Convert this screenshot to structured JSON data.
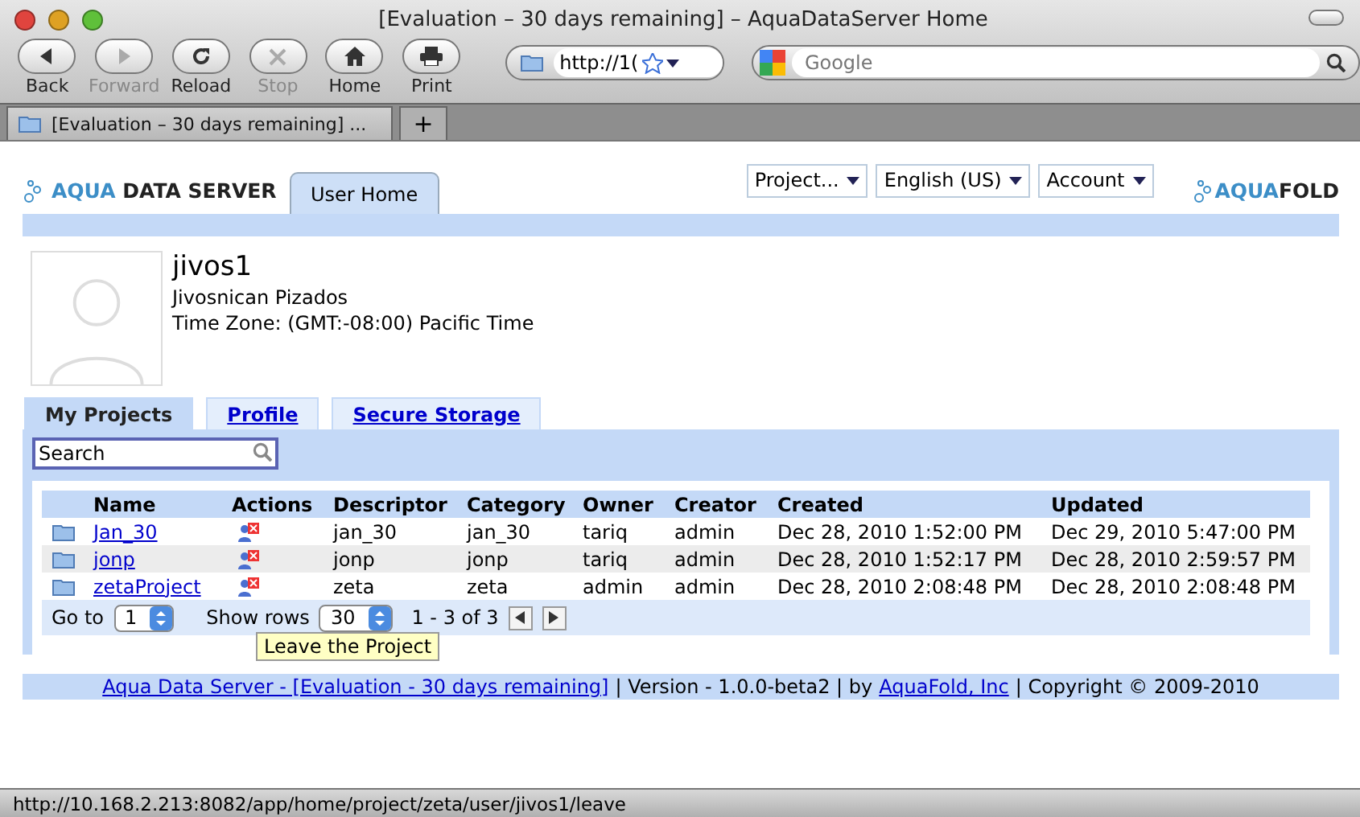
{
  "window": {
    "title": "[Evaluation – 30 days remaining] – AquaDataServer Home"
  },
  "toolbar": [
    {
      "label": "Back",
      "kind": "back",
      "disabled": false
    },
    {
      "label": "Forward",
      "kind": "forward",
      "disabled": true
    },
    {
      "label": "Reload",
      "kind": "reload",
      "disabled": false
    },
    {
      "label": "Stop",
      "kind": "stop",
      "disabled": true
    },
    {
      "label": "Home",
      "kind": "home",
      "disabled": false
    },
    {
      "label": "Print",
      "kind": "print",
      "disabled": false
    }
  ],
  "address": {
    "value": "http://1("
  },
  "web_search": {
    "placeholder": "Google"
  },
  "browser_tabs": [
    {
      "label": "[Evaluation – 30 days remaining] ...",
      "selected": true
    }
  ],
  "new_tab": "+",
  "app": {
    "logo": {
      "part1": "AQUA",
      "part2": "DATA SERVER"
    },
    "nav_tabs": [
      {
        "label": "User Home",
        "selected": true
      }
    ],
    "menus": [
      "Project...",
      "English (US)",
      "Account"
    ],
    "brand": {
      "part1": "AQUA",
      "part2": "FOLD"
    }
  },
  "user": {
    "username": "jivos1",
    "full_name": "Jivosnican Pizados",
    "time_zone": "Time Zone: (GMT:-08:00) Pacific Time"
  },
  "tabs": [
    {
      "label": "My Projects",
      "selected": true
    },
    {
      "label": "Profile",
      "selected": false
    },
    {
      "label": "Secure Storage",
      "selected": false
    }
  ],
  "search": {
    "value": "Search"
  },
  "table": {
    "columns": [
      "Name",
      "Actions",
      "Descriptor",
      "Category",
      "Owner",
      "Creator",
      "Created",
      "Updated"
    ],
    "rows": [
      {
        "name": "Jan_30",
        "descriptor": "jan_30",
        "category": "jan_30",
        "owner": "tariq",
        "creator": "admin",
        "created": "Dec 28, 2010 1:52:00 PM",
        "updated": "Dec 29, 2010 5:47:00 PM"
      },
      {
        "name": "jonp",
        "descriptor": "jonp",
        "category": "jonp",
        "owner": "tariq",
        "creator": "admin",
        "created": "Dec 28, 2010 1:52:17 PM",
        "updated": "Dec 28, 2010 2:59:57 PM"
      },
      {
        "name": "zetaProject",
        "descriptor": "zeta",
        "category": "zeta",
        "owner": "admin",
        "creator": "admin",
        "created": "Dec 28, 2010 2:08:48 PM",
        "updated": "Dec 28, 2010 2:08:48 PM"
      }
    ]
  },
  "pager": {
    "goto_label": "Go to",
    "page": "1",
    "rows_label": "Show rows",
    "rows": "30",
    "range": "1 - 3 of 3"
  },
  "tooltip": "Leave the Project",
  "footer": {
    "link1": "Aqua Data Server - [Evaluation - 30 days remaining]",
    "version": "| Version - 1.0.0-beta2 | by",
    "link2": "AquaFold, Inc",
    "copyright": "| Copyright © 2009-2010"
  },
  "status_bar": "http://10.168.2.213:8082/app/home/project/zeta/user/jivos1/leave"
}
